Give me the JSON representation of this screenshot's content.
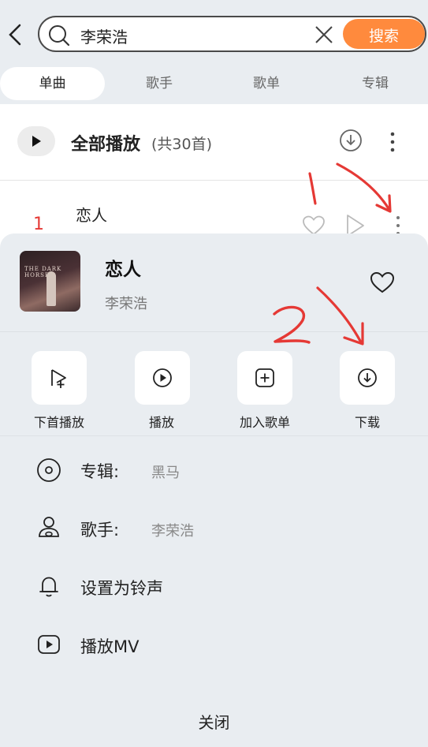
{
  "search": {
    "query": "李荣浩",
    "button_label": "搜索"
  },
  "tabs": [
    {
      "label": "单曲",
      "active": true
    },
    {
      "label": "歌手",
      "active": false
    },
    {
      "label": "歌单",
      "active": false
    },
    {
      "label": "专辑",
      "active": false
    }
  ],
  "list": {
    "play_all_label": "全部播放",
    "play_all_count": "(共30首)",
    "first_song": {
      "rank": "1",
      "title": "恋人"
    }
  },
  "annotations": {
    "mark1": "1",
    "mark2": "2"
  },
  "sheet": {
    "song_title": "恋人",
    "artist": "李荣浩",
    "cover_text": "THE DARK HORSE",
    "actions": [
      {
        "label": "下首播放",
        "icon": "play-next-icon"
      },
      {
        "label": "播放",
        "icon": "play-circle-icon"
      },
      {
        "label": "加入歌单",
        "icon": "add-to-playlist-icon"
      },
      {
        "label": "下载",
        "icon": "download-icon"
      }
    ],
    "rows": [
      {
        "label": "专辑:",
        "value": "黑马",
        "icon": "album-disc-icon"
      },
      {
        "label": "歌手:",
        "value": "李荣浩",
        "icon": "singer-icon"
      },
      {
        "label": "设置为铃声",
        "value": "",
        "icon": "bell-icon"
      },
      {
        "label": "播放MV",
        "value": "",
        "icon": "mv-play-icon"
      }
    ],
    "close_label": "关闭"
  },
  "colors": {
    "accent": "#ff8a3d",
    "annotation": "#e53935",
    "background": "#e9edf1"
  }
}
